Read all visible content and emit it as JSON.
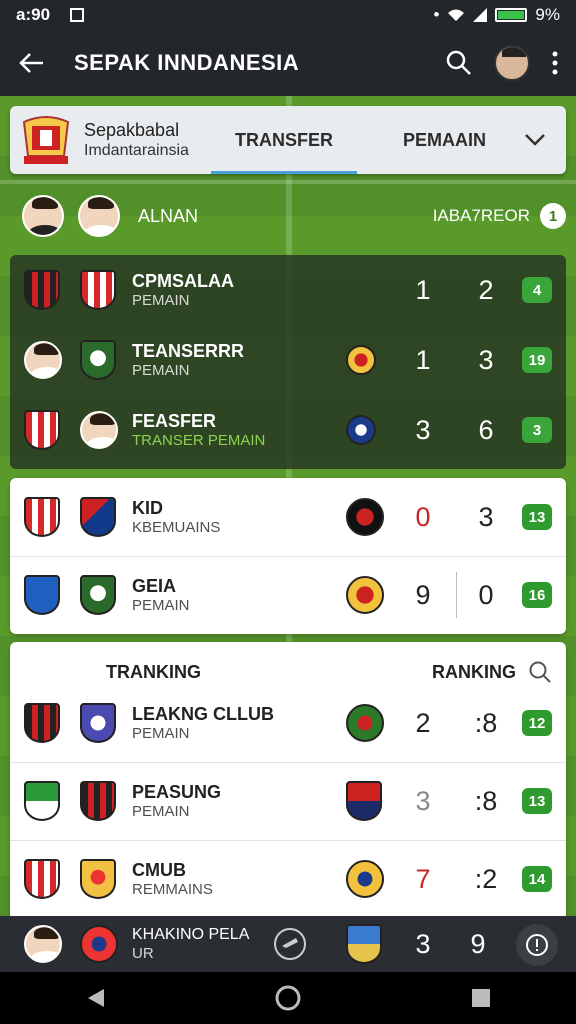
{
  "status": {
    "time": "a:90",
    "battery": "9%"
  },
  "appbar": {
    "title": "SEPAK INNDANESIA"
  },
  "tabs": {
    "club_line1": "Sepakbabal",
    "club_line2": "Imdantarainsia",
    "tab1": "TRANSFER",
    "tab2": "PEMAAIN"
  },
  "header": {
    "name": "ALNAN",
    "right": "IABA7REOR",
    "count": "1"
  },
  "dark_rows": [
    {
      "name": "CPMSALAA",
      "sub": "PEMAIN",
      "s1": "1",
      "s2": "2",
      "badge": "4"
    },
    {
      "name": "TEANSERRR",
      "sub": "PEMAIN",
      "s1": "1",
      "s2": "3",
      "badge": "19"
    },
    {
      "name": "FEASFER",
      "sub": "TRANSER PEMAIN",
      "s1": "3",
      "s2": "6",
      "badge": "3"
    }
  ],
  "light_rows": [
    {
      "name": "KID",
      "sub": "KBEMUAINS",
      "s1": "0",
      "s2": "3",
      "badge": "13"
    },
    {
      "name": "GEIA",
      "sub": "PEMAIN",
      "s1": "9",
      "s2": "0",
      "badge": "16"
    }
  ],
  "ranking": {
    "left": "TRANKING",
    "right": "RANKING",
    "rows": [
      {
        "name": "LEAKNG CLLUB",
        "sub": "PEMAIN",
        "s1": "2",
        "s2": ":8",
        "badge": "12"
      },
      {
        "name": "PEASUNG",
        "sub": "PEMAIN",
        "s1": "3",
        "s2": ":8",
        "badge": "13"
      },
      {
        "name": "CMUB",
        "sub": "REMMAINS",
        "s1": "7",
        "s2": ":2",
        "badge": "14"
      }
    ]
  },
  "bottom": {
    "name": "KHAKINO PELA",
    "sub": "UR",
    "s1": "3",
    "s2": "9"
  },
  "colors": {
    "accent_green": "#2f9a2d",
    "pitch": "#5a9a2a",
    "appbar": "#23272b",
    "tab_indicator": "#4aa0d8"
  }
}
